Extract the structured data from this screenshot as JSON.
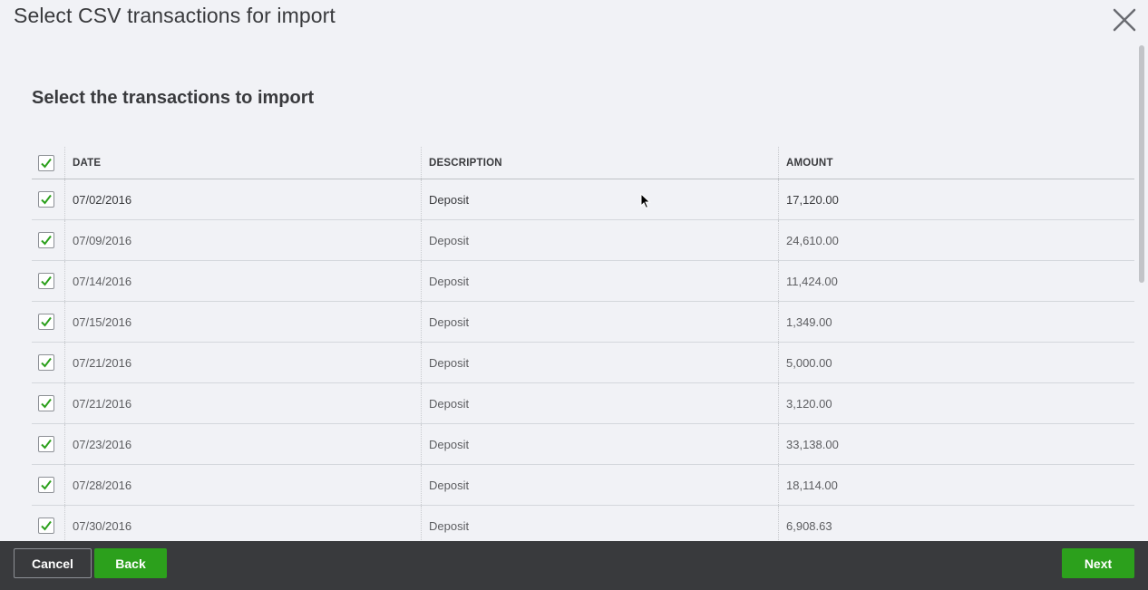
{
  "dialog": {
    "title": "Select CSV transactions for import",
    "close_icon": "close-icon"
  },
  "section": {
    "title": "Select the transactions to import"
  },
  "table": {
    "columns": [
      "DATE",
      "DESCRIPTION",
      "AMOUNT"
    ],
    "select_all_checked": true,
    "rows": [
      {
        "date": "07/02/2016",
        "description": "Deposit",
        "amount": "17,120.00",
        "checked": true
      },
      {
        "date": "07/09/2016",
        "description": "Deposit",
        "amount": "24,610.00",
        "checked": true
      },
      {
        "date": "07/14/2016",
        "description": "Deposit",
        "amount": "11,424.00",
        "checked": true
      },
      {
        "date": "07/15/2016",
        "description": "Deposit",
        "amount": "1,349.00",
        "checked": true
      },
      {
        "date": "07/21/2016",
        "description": "Deposit",
        "amount": "5,000.00",
        "checked": true
      },
      {
        "date": "07/21/2016",
        "description": "Deposit",
        "amount": "3,120.00",
        "checked": true
      },
      {
        "date": "07/23/2016",
        "description": "Deposit",
        "amount": "33,138.00",
        "checked": true
      },
      {
        "date": "07/28/2016",
        "description": "Deposit",
        "amount": "18,114.00",
        "checked": true
      },
      {
        "date": "07/30/2016",
        "description": "Deposit",
        "amount": "6,908.63",
        "checked": true
      }
    ]
  },
  "footer": {
    "cancel_label": "Cancel",
    "back_label": "Back",
    "next_label": "Next"
  },
  "colors": {
    "accent_green": "#2ca01c",
    "footer_bg": "#393a3d",
    "page_bg": "#f1f2f6"
  }
}
